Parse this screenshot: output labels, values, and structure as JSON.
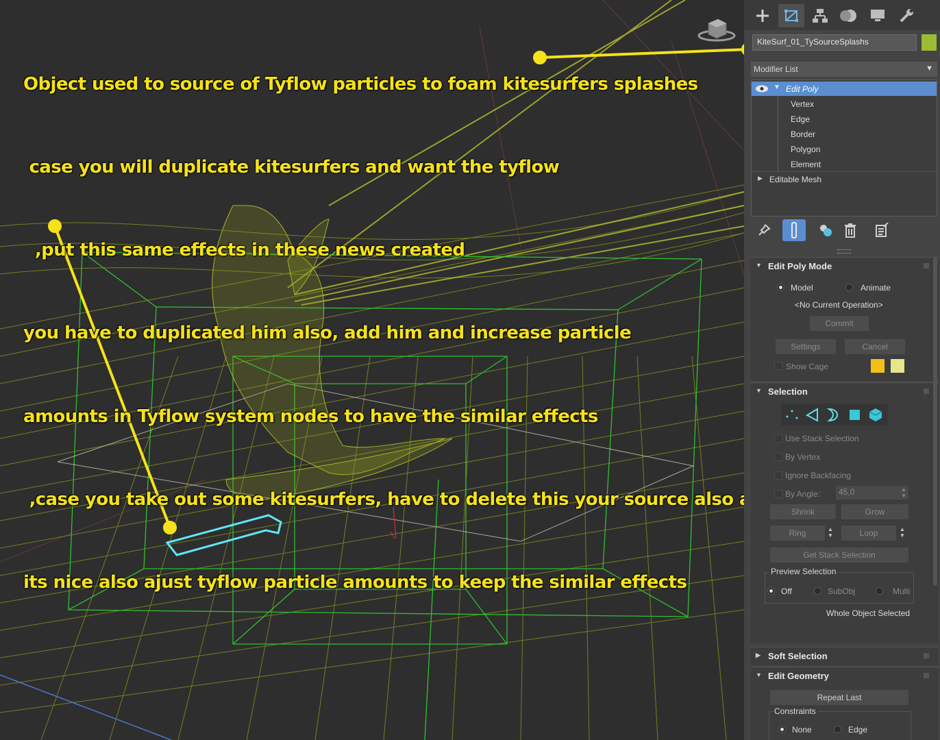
{
  "annotation": {
    "lines": [
      "Object used to source of Tyflow particles to foam kitesurfers splashes",
      " case you will duplicate kitesurfers and want the tyflow",
      "  ,put this same effects in these news created",
      "you have to duplicated him also, add him and increase particle",
      "amounts in Tyflow system nodes to have the similar effects",
      " ,case you take out some kitesurfers, have to delete this your source also and",
      "its nice also ajust tyflow particle amounts to keep the similar effects"
    ],
    "color": "#f5e21a"
  },
  "panel": {
    "tabs": [
      "plus-icon",
      "modify-icon",
      "hierarchy-icon",
      "motion-icon",
      "display-icon",
      "utilities-icon"
    ],
    "object_name": "KiteSurf_01_TySourceSplashs",
    "object_color": "#9cbc32",
    "modifier_list_label": "Modifier List",
    "stack": {
      "edit_poly": "Edit Poly",
      "sub": [
        "Vertex",
        "Edge",
        "Border",
        "Polygon",
        "Element"
      ],
      "editable_mesh": "Editable Mesh"
    },
    "edit_poly_mode": {
      "title": "Edit Poly Mode",
      "model": "Model",
      "animate": "Animate",
      "current_op": "<No Current Operation>",
      "commit": "Commit",
      "settings": "Settings",
      "cancel": "Cancel",
      "show_cage": "Show Cage",
      "cage_colors": [
        "#f2bf1a",
        "#e6e68a"
      ]
    },
    "selection": {
      "title": "Selection",
      "use_stack": "Use Stack Selection",
      "by_vertex": "By Vertex",
      "ignore_backfacing": "Ignore Backfacing",
      "by_angle": "By Angle:",
      "angle_value": "45,0",
      "shrink": "Shrink",
      "grow": "Grow",
      "ring": "Ring",
      "loop": "Loop",
      "get_stack": "Get Stack Selection",
      "preview_title": "Preview Selection",
      "off": "Off",
      "subobj": "SubObj",
      "multi": "Multi",
      "status": "Whole Object Selected"
    },
    "soft_selection": {
      "title": "Soft Selection"
    },
    "edit_geometry": {
      "title": "Edit Geometry",
      "repeat_last": "Repeat Last",
      "constraints": "Constraints",
      "none": "None",
      "edge": "Edge"
    }
  }
}
